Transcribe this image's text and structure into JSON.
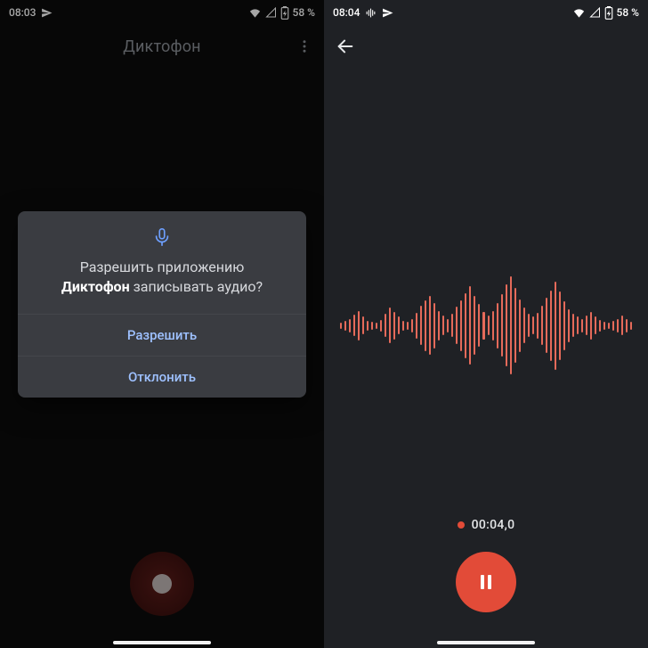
{
  "left": {
    "status": {
      "time": "08:03",
      "battery": "58 %"
    },
    "appTitle": "Диктофон",
    "dialog": {
      "pre": "Разрешить приложению",
      "appName": "Диктофон",
      "post": "записывать аудио?",
      "allow": "Разрешить",
      "deny": "Отклонить"
    }
  },
  "right": {
    "status": {
      "time": "08:04",
      "battery": "58 %"
    },
    "timer": "00:04,0",
    "waveform": [
      6,
      10,
      14,
      22,
      30,
      18,
      10,
      8,
      6,
      12,
      24,
      36,
      28,
      18,
      10,
      8,
      14,
      26,
      40,
      52,
      60,
      46,
      30,
      20,
      14,
      24,
      38,
      52,
      66,
      80,
      60,
      44,
      28,
      20,
      30,
      46,
      64,
      84,
      100,
      76,
      54,
      36,
      24,
      18,
      26,
      40,
      56,
      72,
      90,
      70,
      50,
      34,
      24,
      18,
      14,
      20,
      28,
      18,
      12,
      8,
      6,
      10,
      14,
      20,
      14,
      8
    ]
  },
  "icons": {
    "telegram": "telegram-icon",
    "wifi": "wifi-icon",
    "signal": "signal-icon",
    "battery": "battery-icon",
    "ripple": "ripple-icon"
  }
}
